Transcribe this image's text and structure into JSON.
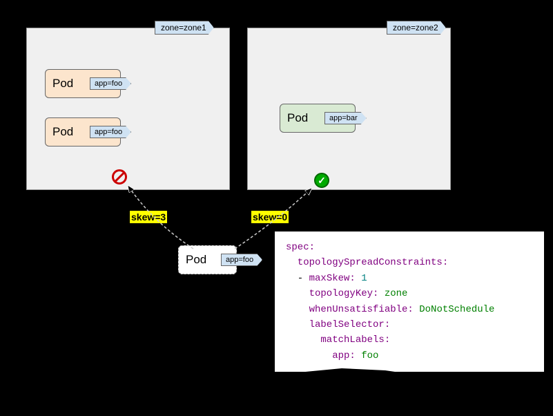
{
  "zone1": {
    "label": "zone=zone1"
  },
  "zone2": {
    "label": "zone=zone2"
  },
  "pod1": {
    "name": "Pod",
    "app": "app=foo"
  },
  "pod2": {
    "name": "Pod",
    "app": "app=foo"
  },
  "pod3": {
    "name": "Pod",
    "app": "app=bar"
  },
  "podNew": {
    "name": "Pod",
    "app": "app=foo"
  },
  "skew1": "skew=3",
  "skew2": "skew=0",
  "code": {
    "l1": "spec:",
    "l2": "  topologySpreadConstraints:",
    "l3a": "  - ",
    "l3b": "maxSkew: ",
    "l3c": "1",
    "l4a": "    topologyKey: ",
    "l4b": "zone",
    "l5a": "    whenUnsatisfiable: ",
    "l5b": "DoNotSchedule",
    "l6": "    labelSelector:",
    "l7": "      matchLabels:",
    "l8a": "        app: ",
    "l8b": "foo"
  }
}
